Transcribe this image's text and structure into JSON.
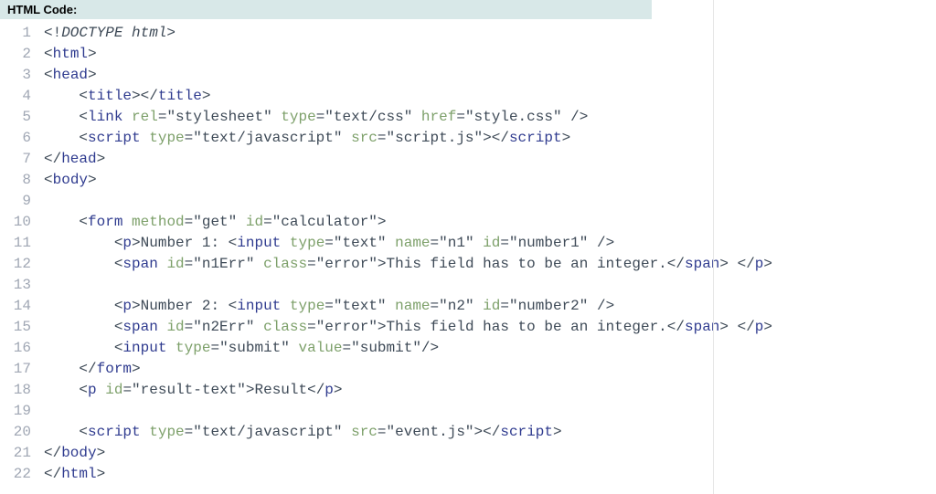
{
  "header": {
    "label": "HTML Code:"
  },
  "lines": [
    {
      "n": "1",
      "segs": [
        [
          "p",
          "<!"
        ],
        [
          "dt",
          "DOCTYPE html"
        ],
        [
          "p",
          ">"
        ]
      ]
    },
    {
      "n": "2",
      "segs": [
        [
          "p",
          "<"
        ],
        [
          "tg",
          "html"
        ],
        [
          "p",
          ">"
        ]
      ]
    },
    {
      "n": "3",
      "segs": [
        [
          "p",
          "<"
        ],
        [
          "tg",
          "head"
        ],
        [
          "p",
          ">"
        ]
      ]
    },
    {
      "n": "4",
      "segs": [
        [
          "p",
          "    <"
        ],
        [
          "tg",
          "title"
        ],
        [
          "p",
          "></"
        ],
        [
          "tg",
          "title"
        ],
        [
          "p",
          ">"
        ]
      ]
    },
    {
      "n": "5",
      "segs": [
        [
          "p",
          "    <"
        ],
        [
          "tg",
          "link"
        ],
        [
          "p",
          " "
        ],
        [
          "an",
          "rel"
        ],
        [
          "p",
          "="
        ],
        [
          "av",
          "\"stylesheet\""
        ],
        [
          "p",
          " "
        ],
        [
          "an",
          "type"
        ],
        [
          "p",
          "="
        ],
        [
          "av",
          "\"text/css\""
        ],
        [
          "p",
          " "
        ],
        [
          "an",
          "href"
        ],
        [
          "p",
          "="
        ],
        [
          "av",
          "\"style.css\""
        ],
        [
          "p",
          " />"
        ]
      ]
    },
    {
      "n": "6",
      "segs": [
        [
          "p",
          "    <"
        ],
        [
          "tg",
          "script"
        ],
        [
          "p",
          " "
        ],
        [
          "an",
          "type"
        ],
        [
          "p",
          "="
        ],
        [
          "av",
          "\"text/javascript\""
        ],
        [
          "p",
          " "
        ],
        [
          "an",
          "src"
        ],
        [
          "p",
          "="
        ],
        [
          "av",
          "\"script.js\""
        ],
        [
          "p",
          "></"
        ],
        [
          "tg",
          "script"
        ],
        [
          "p",
          ">"
        ]
      ]
    },
    {
      "n": "7",
      "segs": [
        [
          "p",
          "</"
        ],
        [
          "tg",
          "head"
        ],
        [
          "p",
          ">"
        ]
      ]
    },
    {
      "n": "8",
      "segs": [
        [
          "p",
          "<"
        ],
        [
          "tg",
          "body"
        ],
        [
          "p",
          ">"
        ]
      ]
    },
    {
      "n": "9",
      "segs": []
    },
    {
      "n": "10",
      "segs": [
        [
          "p",
          "    <"
        ],
        [
          "tg",
          "form"
        ],
        [
          "p",
          " "
        ],
        [
          "an",
          "method"
        ],
        [
          "p",
          "="
        ],
        [
          "av",
          "\"get\""
        ],
        [
          "p",
          " "
        ],
        [
          "an",
          "id"
        ],
        [
          "p",
          "="
        ],
        [
          "av",
          "\"calculator\""
        ],
        [
          "p",
          ">"
        ]
      ]
    },
    {
      "n": "11",
      "segs": [
        [
          "p",
          "        <"
        ],
        [
          "tg",
          "p"
        ],
        [
          "p",
          ">"
        ],
        [
          "tx",
          "Number 1: "
        ],
        [
          "p",
          "<"
        ],
        [
          "tg",
          "input"
        ],
        [
          "p",
          " "
        ],
        [
          "an",
          "type"
        ],
        [
          "p",
          "="
        ],
        [
          "av",
          "\"text\""
        ],
        [
          "p",
          " "
        ],
        [
          "an",
          "name"
        ],
        [
          "p",
          "="
        ],
        [
          "av",
          "\"n1\""
        ],
        [
          "p",
          " "
        ],
        [
          "an",
          "id"
        ],
        [
          "p",
          "="
        ],
        [
          "av",
          "\"number1\""
        ],
        [
          "p",
          " />"
        ]
      ]
    },
    {
      "n": "12",
      "segs": [
        [
          "p",
          "        <"
        ],
        [
          "tg",
          "span"
        ],
        [
          "p",
          " "
        ],
        [
          "an",
          "id"
        ],
        [
          "p",
          "="
        ],
        [
          "av",
          "\"n1Err\""
        ],
        [
          "p",
          " "
        ],
        [
          "an",
          "class"
        ],
        [
          "p",
          "="
        ],
        [
          "av",
          "\"error\""
        ],
        [
          "p",
          ">"
        ],
        [
          "tx",
          "This field has to be an integer."
        ],
        [
          "p",
          "</"
        ],
        [
          "tg",
          "span"
        ],
        [
          "p",
          "> </"
        ],
        [
          "tg",
          "p"
        ],
        [
          "p",
          ">"
        ]
      ]
    },
    {
      "n": "13",
      "segs": []
    },
    {
      "n": "14",
      "segs": [
        [
          "p",
          "        <"
        ],
        [
          "tg",
          "p"
        ],
        [
          "p",
          ">"
        ],
        [
          "tx",
          "Number 2: "
        ],
        [
          "p",
          "<"
        ],
        [
          "tg",
          "input"
        ],
        [
          "p",
          " "
        ],
        [
          "an",
          "type"
        ],
        [
          "p",
          "="
        ],
        [
          "av",
          "\"text\""
        ],
        [
          "p",
          " "
        ],
        [
          "an",
          "name"
        ],
        [
          "p",
          "="
        ],
        [
          "av",
          "\"n2\""
        ],
        [
          "p",
          " "
        ],
        [
          "an",
          "id"
        ],
        [
          "p",
          "="
        ],
        [
          "av",
          "\"number2\""
        ],
        [
          "p",
          " />"
        ]
      ]
    },
    {
      "n": "15",
      "segs": [
        [
          "p",
          "        <"
        ],
        [
          "tg",
          "span"
        ],
        [
          "p",
          " "
        ],
        [
          "an",
          "id"
        ],
        [
          "p",
          "="
        ],
        [
          "av",
          "\"n2Err\""
        ],
        [
          "p",
          " "
        ],
        [
          "an",
          "class"
        ],
        [
          "p",
          "="
        ],
        [
          "av",
          "\"error\""
        ],
        [
          "p",
          ">"
        ],
        [
          "tx",
          "This field has to be an integer."
        ],
        [
          "p",
          "</"
        ],
        [
          "tg",
          "span"
        ],
        [
          "p",
          "> </"
        ],
        [
          "tg",
          "p"
        ],
        [
          "p",
          ">"
        ]
      ]
    },
    {
      "n": "16",
      "segs": [
        [
          "p",
          "        <"
        ],
        [
          "tg",
          "input"
        ],
        [
          "p",
          " "
        ],
        [
          "an",
          "type"
        ],
        [
          "p",
          "="
        ],
        [
          "av",
          "\"submit\""
        ],
        [
          "p",
          " "
        ],
        [
          "an",
          "value"
        ],
        [
          "p",
          "="
        ],
        [
          "av",
          "\"submit\""
        ],
        [
          "p",
          "/>"
        ]
      ]
    },
    {
      "n": "17",
      "segs": [
        [
          "p",
          "    </"
        ],
        [
          "tg",
          "form"
        ],
        [
          "p",
          ">"
        ]
      ]
    },
    {
      "n": "18",
      "segs": [
        [
          "p",
          "    <"
        ],
        [
          "tg",
          "p"
        ],
        [
          "p",
          " "
        ],
        [
          "an",
          "id"
        ],
        [
          "p",
          "="
        ],
        [
          "av",
          "\"result-text\""
        ],
        [
          "p",
          ">"
        ],
        [
          "tx",
          "Result"
        ],
        [
          "p",
          "</"
        ],
        [
          "tg",
          "p"
        ],
        [
          "p",
          ">"
        ]
      ]
    },
    {
      "n": "19",
      "segs": []
    },
    {
      "n": "20",
      "segs": [
        [
          "p",
          "    <"
        ],
        [
          "tg",
          "script"
        ],
        [
          "p",
          " "
        ],
        [
          "an",
          "type"
        ],
        [
          "p",
          "="
        ],
        [
          "av",
          "\"text/javascript\""
        ],
        [
          "p",
          " "
        ],
        [
          "an",
          "src"
        ],
        [
          "p",
          "="
        ],
        [
          "av",
          "\"event.js\""
        ],
        [
          "p",
          "></"
        ],
        [
          "tg",
          "script"
        ],
        [
          "p",
          ">"
        ]
      ]
    },
    {
      "n": "21",
      "segs": [
        [
          "p",
          "</"
        ],
        [
          "tg",
          "body"
        ],
        [
          "p",
          ">"
        ]
      ]
    },
    {
      "n": "22",
      "segs": [
        [
          "p",
          "</"
        ],
        [
          "tg",
          "html"
        ],
        [
          "p",
          ">"
        ]
      ]
    }
  ]
}
